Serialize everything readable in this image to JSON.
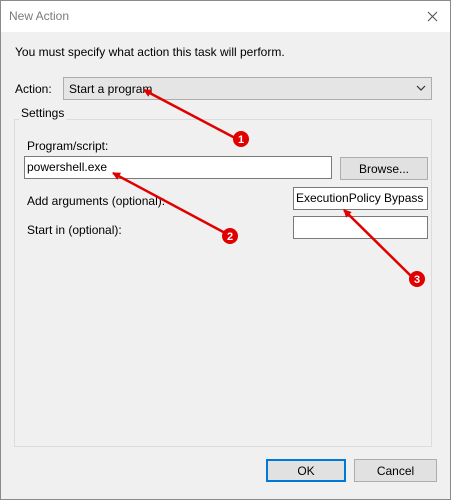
{
  "window": {
    "title": "New Action",
    "close_icon": "close-icon"
  },
  "intro": "You must specify what action this task will perform.",
  "action": {
    "label": "Action:",
    "selected": "Start a program",
    "chevron_icon": "chevron-down-icon"
  },
  "settings": {
    "title": "Settings",
    "program_label": "Program/script:",
    "program_value": "powershell.exe",
    "browse_label": "Browse...",
    "arguments_label": "Add arguments (optional):",
    "arguments_value": "ExecutionPolicy Bypass -",
    "startin_label": "Start in (optional):",
    "startin_value": ""
  },
  "buttons": {
    "ok": "OK",
    "cancel": "Cancel"
  },
  "annotations": {
    "color": "#e00000",
    "markers": [
      "1",
      "2",
      "3"
    ]
  }
}
